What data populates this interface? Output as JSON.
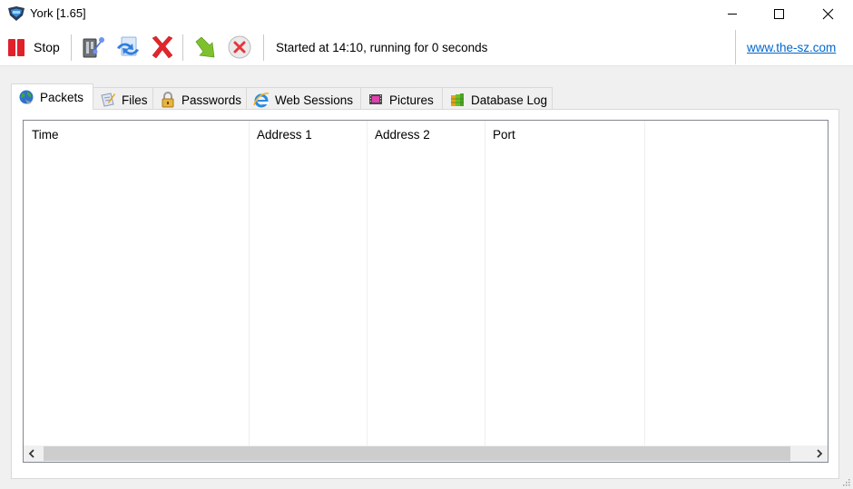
{
  "window": {
    "title": "York [1.65]",
    "icon": "york-shield-icon",
    "controls": {
      "minimize": "minimize-icon",
      "maximize": "maximize-icon",
      "close": "close-icon"
    }
  },
  "toolbar": {
    "stop_label": "Stop",
    "buttons": [
      {
        "name": "connect-interface-button",
        "icon": "network-switch-icon"
      },
      {
        "name": "refresh-sessions-button",
        "icon": "transfer-arrows-icon"
      },
      {
        "name": "clear-button",
        "icon": "red-x-icon"
      },
      {
        "name": "export-button",
        "icon": "green-arrow-icon"
      },
      {
        "name": "cancel-button",
        "icon": "circle-x-icon"
      }
    ],
    "status": "Started at 14:10, running for 0 seconds",
    "link": "www.the-sz.com"
  },
  "tabs": [
    {
      "label": "Packets",
      "icon": "globe-icon",
      "active": true
    },
    {
      "label": "Files",
      "icon": "document-pen-icon",
      "active": false
    },
    {
      "label": "Passwords",
      "icon": "padlock-icon",
      "active": false
    },
    {
      "label": "Web Sessions",
      "icon": "internet-explorer-icon",
      "active": false
    },
    {
      "label": "Pictures",
      "icon": "film-picture-icon",
      "active": false
    },
    {
      "label": "Database Log",
      "icon": "database-icon",
      "active": false
    }
  ],
  "table": {
    "columns": [
      "Time",
      "Address 1",
      "Address 2",
      "Port",
      ""
    ],
    "rows": []
  },
  "scrollbar": {
    "left_arrow": "‹",
    "right_arrow": "›"
  },
  "colors": {
    "stop_red": "#e0202a",
    "link_blue": "#0066cc",
    "background": "#f0f0f0"
  }
}
